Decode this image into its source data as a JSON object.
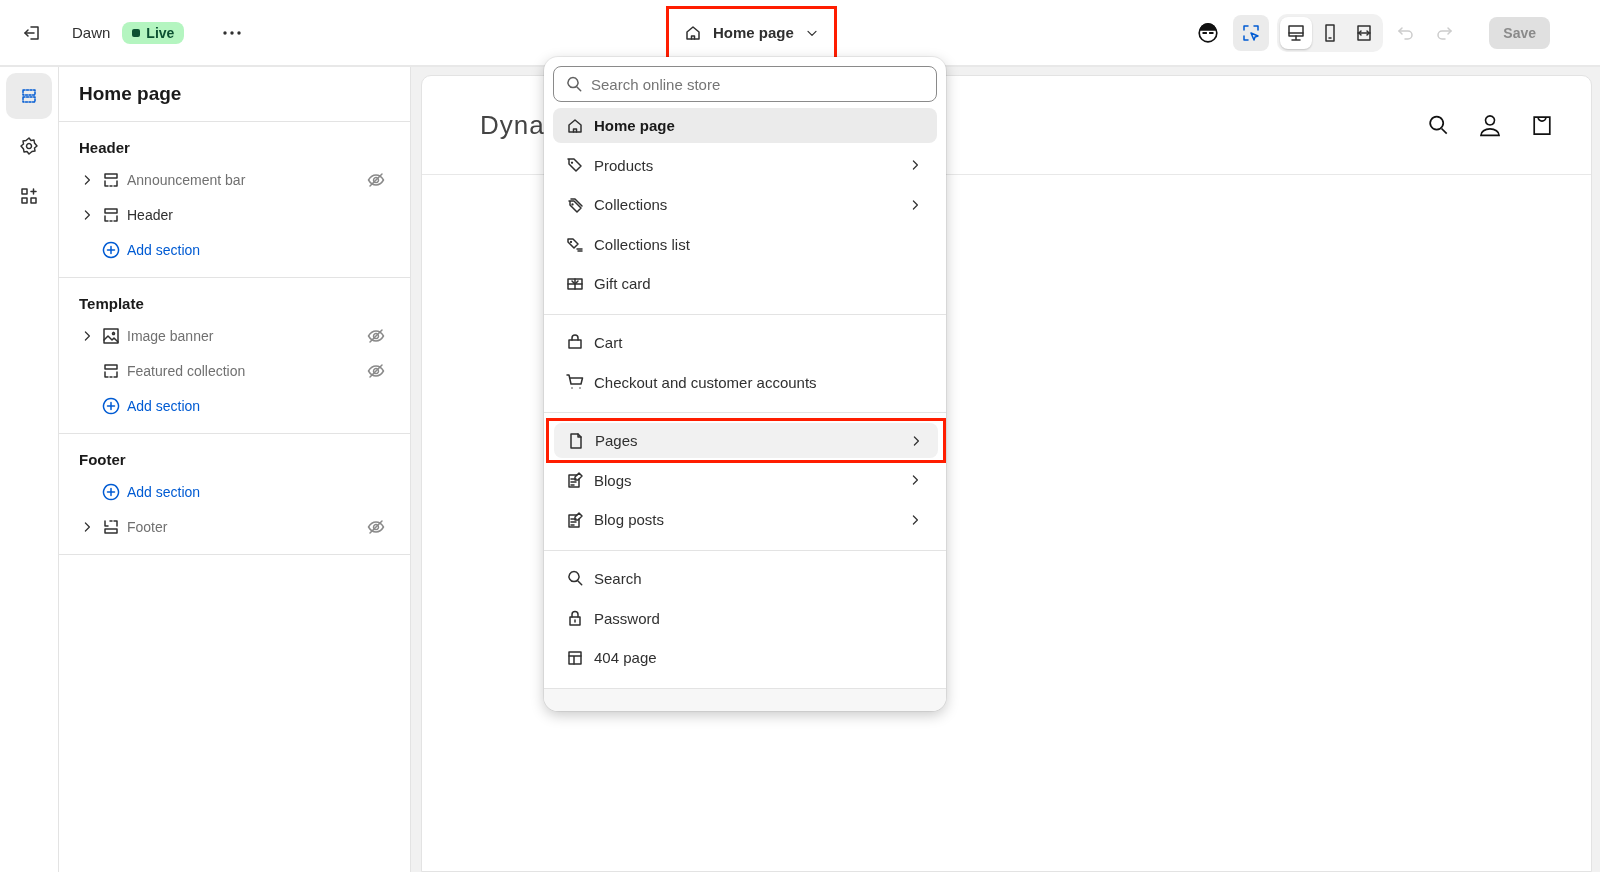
{
  "topbar": {
    "theme_name": "Dawn",
    "status": "Live",
    "page_picker": {
      "label": "Home page",
      "highlighted": true
    },
    "inspector": {
      "selected": true
    },
    "devices": [
      {
        "kind": "desktop",
        "selected": true
      },
      {
        "kind": "mobile",
        "selected": false
      },
      {
        "kind": "fullwidth",
        "selected": false
      }
    ],
    "undo": {
      "disabled": true
    },
    "redo": {
      "disabled": true
    },
    "save": {
      "label": "Save",
      "disabled": true
    }
  },
  "rail": [
    {
      "kind": "sections",
      "selected": true
    },
    {
      "kind": "settings",
      "selected": false
    },
    {
      "kind": "apps",
      "selected": false
    }
  ],
  "sidebar": {
    "title": "Home page",
    "groups": [
      {
        "heading": "Header",
        "items": [
          {
            "kind": "section",
            "label": "Announcement bar",
            "expandable": true,
            "hidden": true
          },
          {
            "kind": "section",
            "label": "Header",
            "expandable": true,
            "hidden": false
          },
          {
            "kind": "add",
            "label": "Add section"
          }
        ]
      },
      {
        "heading": "Template",
        "items": [
          {
            "kind": "image",
            "label": "Image banner",
            "expandable": true,
            "hidden": true
          },
          {
            "kind": "section",
            "label": "Featured collection",
            "expandable": false,
            "hidden": true
          },
          {
            "kind": "add",
            "label": "Add section"
          }
        ]
      },
      {
        "heading": "Footer",
        "items": [
          {
            "kind": "add",
            "label": "Add section"
          },
          {
            "kind": "footer",
            "label": "Footer",
            "expandable": true,
            "hidden": true
          }
        ]
      }
    ]
  },
  "preview": {
    "store_name": "Dyna"
  },
  "menu": {
    "search_placeholder": "Search online store",
    "groups": [
      {
        "items": [
          {
            "label": "Home page",
            "kind": "home",
            "submenu": false,
            "selected": true,
            "highlighted": false
          },
          {
            "label": "Products",
            "kind": "tag",
            "submenu": true,
            "selected": false,
            "highlighted": false
          },
          {
            "label": "Collections",
            "kind": "tags",
            "submenu": true,
            "selected": false,
            "highlighted": false
          },
          {
            "label": "Collections list",
            "kind": "taglist",
            "submenu": false,
            "selected": false,
            "highlighted": false
          },
          {
            "label": "Gift card",
            "kind": "gift",
            "submenu": false,
            "selected": false,
            "highlighted": false
          }
        ]
      },
      {
        "items": [
          {
            "label": "Cart",
            "kind": "bag",
            "submenu": false,
            "selected": false,
            "highlighted": false
          },
          {
            "label": "Checkout and customer accounts",
            "kind": "cart",
            "submenu": false,
            "selected": false,
            "highlighted": false
          }
        ]
      },
      {
        "items": [
          {
            "label": "Pages",
            "kind": "page",
            "submenu": true,
            "selected": false,
            "highlighted": true
          },
          {
            "label": "Blogs",
            "kind": "blog",
            "submenu": true,
            "selected": false,
            "highlighted": false
          },
          {
            "label": "Blog posts",
            "kind": "blog",
            "submenu": true,
            "selected": false,
            "highlighted": false
          }
        ]
      },
      {
        "items": [
          {
            "label": "Search",
            "kind": "search",
            "submenu": false,
            "selected": false,
            "highlighted": false
          },
          {
            "label": "Password",
            "kind": "lock",
            "submenu": false,
            "selected": false,
            "highlighted": false
          },
          {
            "label": "404 page",
            "kind": "layout",
            "submenu": false,
            "selected": false,
            "highlighted": false
          }
        ]
      }
    ]
  }
}
